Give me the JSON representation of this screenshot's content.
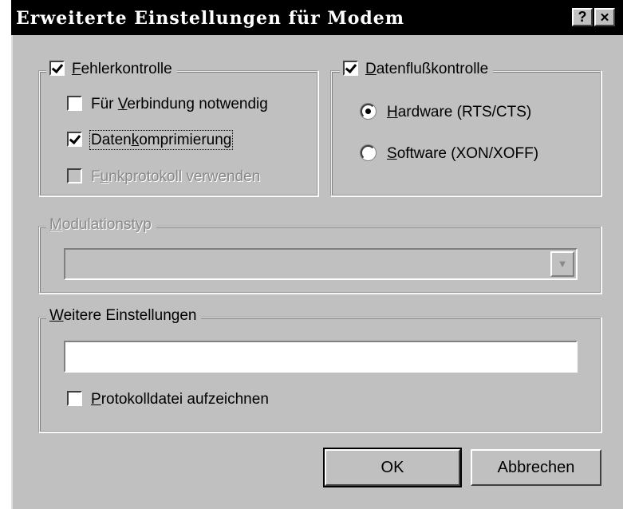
{
  "title": "Erweiterte Einstellungen für Modem",
  "title_buttons": {
    "help": "?",
    "close": "✕"
  },
  "error_control": {
    "label_prefix": "",
    "label_mnemonic": "F",
    "label_rest": "ehlerkontrolle",
    "checked": true,
    "options": [
      {
        "pre": "Für ",
        "mn": "V",
        "post": "erbindung notwendig",
        "checked": false,
        "disabled": false
      },
      {
        "pre": "Daten",
        "mn": "k",
        "post": "omprimierung",
        "checked": true,
        "disabled": false
      },
      {
        "pre": "F",
        "mn": "u",
        "post": "nkprotokoll verwenden",
        "checked": false,
        "disabled": true
      }
    ]
  },
  "flow_control": {
    "label_mnemonic": "D",
    "label_rest": "atenflußkontrolle",
    "checked": true,
    "options": [
      {
        "mn": "H",
        "post": "ardware (RTS/CTS)",
        "selected": true
      },
      {
        "mn": "S",
        "post": "oftware (XON/XOFF)",
        "selected": false
      }
    ]
  },
  "modulation": {
    "label_mnemonic": "M",
    "label_rest": "odulationstyp",
    "value": "",
    "disabled": true,
    "arrow": "▼"
  },
  "extra_settings": {
    "label_mnemonic": "W",
    "label_rest": "eitere Einstellungen",
    "value": "",
    "log_checkbox": {
      "mn": "P",
      "post": "rotokolldatei aufzeichnen",
      "checked": false
    }
  },
  "buttons": {
    "ok": "OK",
    "cancel": "Abbrechen"
  }
}
